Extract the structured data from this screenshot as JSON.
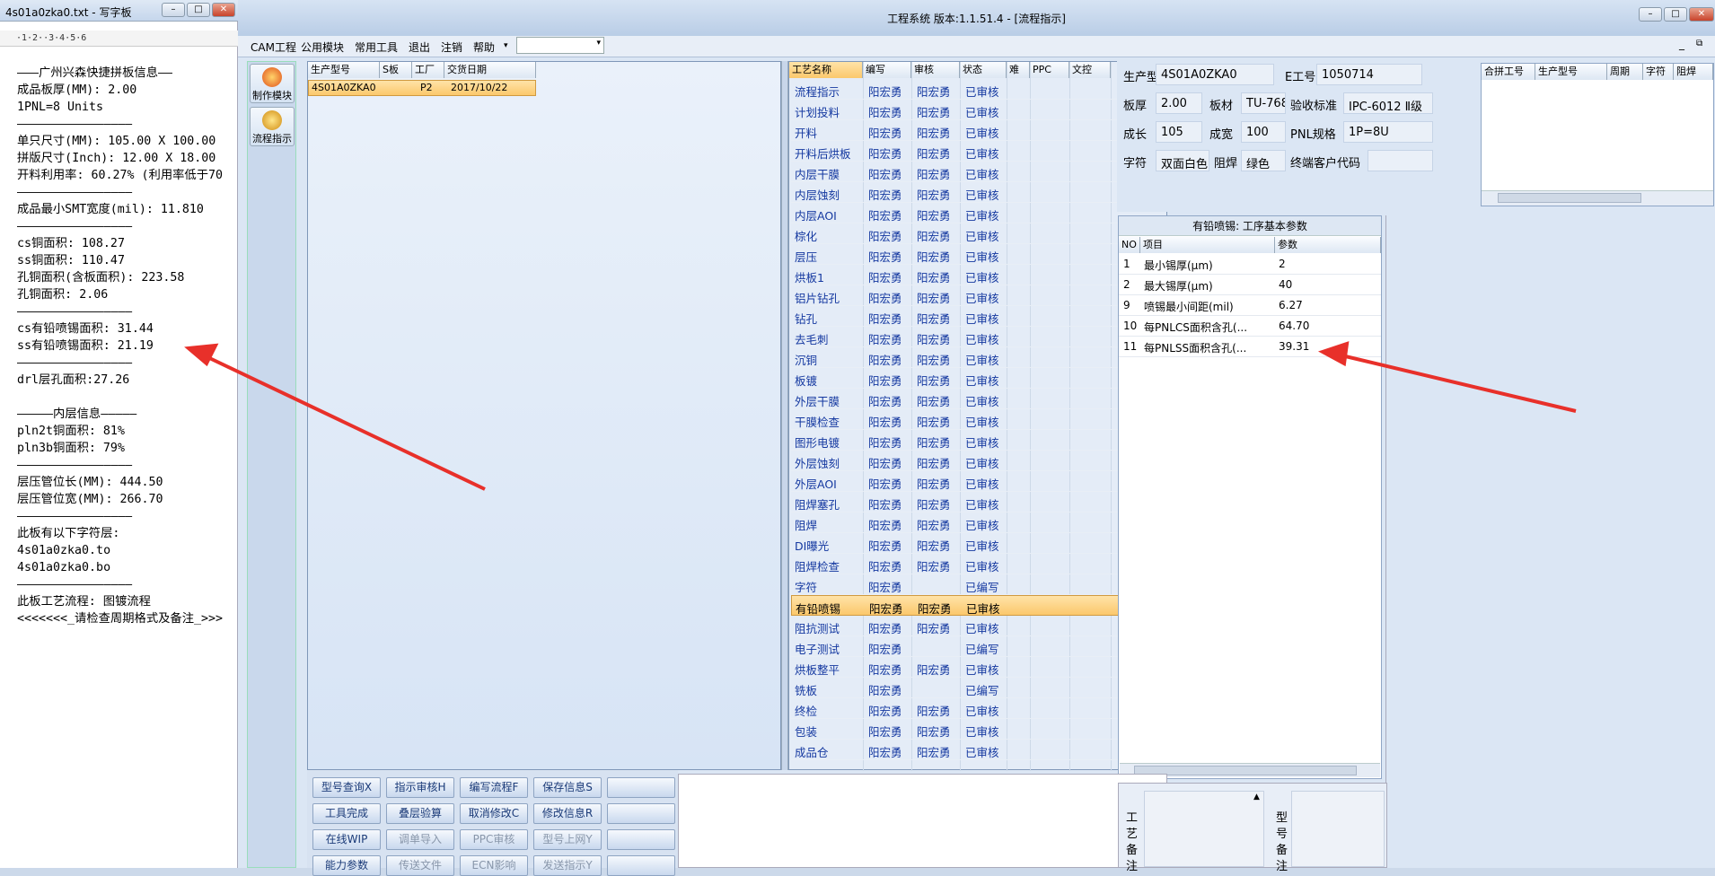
{
  "notepad": {
    "title": "4s01a0zka0.txt - 写字板",
    "ruler": "·1·2··3·4·5·6",
    "lines": [
      "———广州兴森快捷拼板信息——",
      "成品板厚(MM): 2.00",
      "1PNL=8 Units",
      "————————————————",
      "单只尺寸(MM): 105.00 X 100.00",
      "拼版尺寸(Inch): 12.00 X 18.00",
      "开料利用率: 60.27% (利用率低于70",
      "————————————————",
      "成品最小SMT宽度(mil): 11.810",
      "————————————————",
      "cs铜面积: 108.27",
      "ss铜面积: 110.47",
      "孔铜面积(含板面积): 223.58",
      "孔铜面积: 2.06",
      "————————————————",
      "cs有铅喷锡面积: 31.44",
      "ss有铅喷锡面积: 21.19",
      "————————————————",
      "drl层孔面积:27.26",
      "",
      "—————内层信息—————",
      "pln2t铜面积: 81%",
      "pln3b铜面积: 79%",
      "————————————————",
      "层压管位长(MM): 444.50",
      "层压管位宽(MM): 266.70",
      "————————————————",
      "此板有以下字符层:",
      "4s01a0zka0.to",
      "4s01a0zka0.bo",
      "————————————————",
      "此板工艺流程: 图镀流程",
      "<<<<<<<_请检查周期格式及备注_>>>"
    ]
  },
  "app": {
    "title": "工程系统   版本:1.1.51.4 - [流程指示]",
    "menu": [
      "CAM工程",
      "公用模块",
      "常用工具",
      "退出",
      "注销",
      "帮助"
    ],
    "tools": [
      {
        "label": "制作模块",
        "icon": "production-module-icon"
      },
      {
        "label": "流程指示",
        "icon": "flow-indicator-icon"
      }
    ]
  },
  "order_grid": {
    "headers": [
      "生产型号",
      "S板",
      "工厂",
      "交货日期"
    ],
    "row": {
      "model": "4S01A0ZKA0",
      "s": "",
      "factory": "P2",
      "date": "2017/10/22"
    }
  },
  "process_grid": {
    "headers": [
      "工艺名称",
      "编写",
      "审核",
      "状态",
      "难",
      "PPC",
      "文控"
    ],
    "rows": [
      {
        "name": "流程指示",
        "writer": "阳宏勇",
        "reviewer": "阳宏勇",
        "status": "已审核"
      },
      {
        "name": "计划投料",
        "writer": "阳宏勇",
        "reviewer": "阳宏勇",
        "status": "已审核"
      },
      {
        "name": "开料",
        "writer": "阳宏勇",
        "reviewer": "阳宏勇",
        "status": "已审核"
      },
      {
        "name": "开料后烘板",
        "writer": "阳宏勇",
        "reviewer": "阳宏勇",
        "status": "已审核"
      },
      {
        "name": "内层干膜",
        "writer": "阳宏勇",
        "reviewer": "阳宏勇",
        "status": "已审核"
      },
      {
        "name": "内层蚀刻",
        "writer": "阳宏勇",
        "reviewer": "阳宏勇",
        "status": "已审核"
      },
      {
        "name": "内层AOI",
        "writer": "阳宏勇",
        "reviewer": "阳宏勇",
        "status": "已审核"
      },
      {
        "name": "棕化",
        "writer": "阳宏勇",
        "reviewer": "阳宏勇",
        "status": "已审核"
      },
      {
        "name": "层压",
        "writer": "阳宏勇",
        "reviewer": "阳宏勇",
        "status": "已审核"
      },
      {
        "name": "烘板1",
        "writer": "阳宏勇",
        "reviewer": "阳宏勇",
        "status": "已审核"
      },
      {
        "name": "铝片钻孔",
        "writer": "阳宏勇",
        "reviewer": "阳宏勇",
        "status": "已审核"
      },
      {
        "name": "钻孔",
        "writer": "阳宏勇",
        "reviewer": "阳宏勇",
        "status": "已审核"
      },
      {
        "name": "去毛刺",
        "writer": "阳宏勇",
        "reviewer": "阳宏勇",
        "status": "已审核"
      },
      {
        "name": "沉铜",
        "writer": "阳宏勇",
        "reviewer": "阳宏勇",
        "status": "已审核"
      },
      {
        "name": "板镀",
        "writer": "阳宏勇",
        "reviewer": "阳宏勇",
        "status": "已审核"
      },
      {
        "name": "外层干膜",
        "writer": "阳宏勇",
        "reviewer": "阳宏勇",
        "status": "已审核"
      },
      {
        "name": "干膜检查",
        "writer": "阳宏勇",
        "reviewer": "阳宏勇",
        "status": "已审核"
      },
      {
        "name": "图形电镀",
        "writer": "阳宏勇",
        "reviewer": "阳宏勇",
        "status": "已审核"
      },
      {
        "name": "外层蚀刻",
        "writer": "阳宏勇",
        "reviewer": "阳宏勇",
        "status": "已审核"
      },
      {
        "name": "外层AOI",
        "writer": "阳宏勇",
        "reviewer": "阳宏勇",
        "status": "已审核"
      },
      {
        "name": "阻焊塞孔",
        "writer": "阳宏勇",
        "reviewer": "阳宏勇",
        "status": "已审核"
      },
      {
        "name": "阻焊",
        "writer": "阳宏勇",
        "reviewer": "阳宏勇",
        "status": "已审核"
      },
      {
        "name": "DI曝光",
        "writer": "阳宏勇",
        "reviewer": "阳宏勇",
        "status": "已审核"
      },
      {
        "name": "阻焊检查",
        "writer": "阳宏勇",
        "reviewer": "阳宏勇",
        "status": "已审核"
      },
      {
        "name": "字符",
        "writer": "阳宏勇",
        "reviewer": "",
        "status": "已编写"
      },
      {
        "name": "有铅喷锡",
        "writer": "阳宏勇",
        "reviewer": "阳宏勇",
        "status": "已审核",
        "selected": true
      },
      {
        "name": "阻抗测试",
        "writer": "阳宏勇",
        "reviewer": "阳宏勇",
        "status": "已审核"
      },
      {
        "name": "电子测试",
        "writer": "阳宏勇",
        "reviewer": "",
        "status": "已编写"
      },
      {
        "name": "烘板整平",
        "writer": "阳宏勇",
        "reviewer": "阳宏勇",
        "status": "已审核"
      },
      {
        "name": "铣板",
        "writer": "阳宏勇",
        "reviewer": "",
        "status": "已编写"
      },
      {
        "name": "终检",
        "writer": "阳宏勇",
        "reviewer": "阳宏勇",
        "status": "已审核"
      },
      {
        "name": "包装",
        "writer": "阳宏勇",
        "reviewer": "阳宏勇",
        "status": "已审核"
      },
      {
        "name": "成品仓",
        "writer": "阳宏勇",
        "reviewer": "阳宏勇",
        "status": "已审核"
      }
    ]
  },
  "info": {
    "model_label": "生产型号",
    "model": "4S01A0ZKA0",
    "eno_label": "E工号",
    "eno": "1050714",
    "thick_label": "板厚",
    "thick": "2.00",
    "material_label": "板材",
    "material": "TU-768",
    "std_label": "验收标准",
    "std": "IPC-6012 Ⅱ级",
    "len_label": "成长",
    "len": "105",
    "wid_label": "成宽",
    "wid": "100",
    "pnl_label": "PNL规格",
    "pnl": "1P=8U",
    "char_label": "字符",
    "char": "双面白色",
    "mask_label": "阻焊",
    "mask": "绿色",
    "cust_label": "终端客户代码",
    "cust": ""
  },
  "combo_grid": {
    "headers": [
      "合拼工号",
      "生产型号",
      "周期",
      "字符",
      "阻焊"
    ]
  },
  "params": {
    "caption": "有铅喷锡: 工序基本参数",
    "headers": [
      "NO",
      "项目",
      "参数"
    ],
    "rows": [
      {
        "no": "1",
        "item": "最小锡厚(μm)",
        "value": "2"
      },
      {
        "no": "2",
        "item": "最大锡厚(μm)",
        "value": "40"
      },
      {
        "no": "9",
        "item": "喷锡最小间距(mil)",
        "value": "6.27"
      },
      {
        "no": "10",
        "item": "每PNLCS面积含孔(...",
        "value": "64.70"
      },
      {
        "no": "11",
        "item": "每PNLSS面积含孔(...",
        "value": "39.31"
      }
    ]
  },
  "buttons": {
    "row1": [
      "型号查询X",
      "指示审核H",
      "编写流程F",
      "保存信息S",
      ""
    ],
    "row2": [
      "工具完成",
      "叠层验算",
      "取消修改C",
      "修改信息R",
      ""
    ],
    "row3": [
      "在线WIP",
      "调单导入",
      "PPC审核",
      "型号上网Y",
      ""
    ],
    "row4": [
      "能力参数",
      "传送文件",
      "ECN影响",
      "发送指示Y",
      ""
    ]
  },
  "remarks": {
    "process": "工艺备注",
    "model": "型号备注"
  },
  "colors": {
    "selected_row": "#fbc86c",
    "link": "#1438a0",
    "arrow": "#e8302a"
  }
}
